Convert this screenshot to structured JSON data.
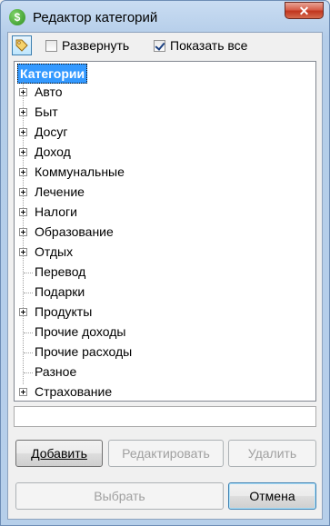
{
  "window": {
    "title": "Редактор категорий",
    "app_icon_glyph": "$",
    "close_glyph": "✕"
  },
  "toolbar": {
    "icon": "tag-icon",
    "expand_label": "Развернуть",
    "expand_checked": false,
    "show_all_label": "Показать все",
    "show_all_checked": true
  },
  "tree": {
    "root": "Категории",
    "items": [
      {
        "label": "Авто",
        "expandable": true
      },
      {
        "label": "Быт",
        "expandable": true
      },
      {
        "label": "Досуг",
        "expandable": true
      },
      {
        "label": "Доход",
        "expandable": true
      },
      {
        "label": "Коммунальные",
        "expandable": true
      },
      {
        "label": "Лечение",
        "expandable": true
      },
      {
        "label": "Налоги",
        "expandable": true
      },
      {
        "label": "Образование",
        "expandable": true
      },
      {
        "label": "Отдых",
        "expandable": true
      },
      {
        "label": "Перевод",
        "expandable": false
      },
      {
        "label": "Подарки",
        "expandable": false
      },
      {
        "label": "Продукты",
        "expandable": true
      },
      {
        "label": "Прочие доходы",
        "expandable": false
      },
      {
        "label": "Прочие расходы",
        "expandable": false
      },
      {
        "label": "Разное",
        "expandable": false
      },
      {
        "label": "Страхование",
        "expandable": true
      }
    ]
  },
  "buttons": {
    "add_label": "Добавить",
    "edit_label": "Редактировать",
    "delete_label": "Удалить",
    "select_label": "Выбрать",
    "cancel_label": "Отмена"
  }
}
